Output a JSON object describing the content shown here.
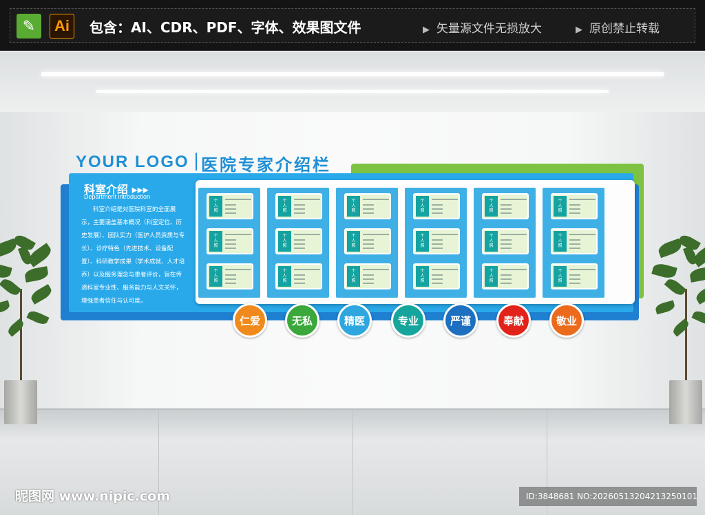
{
  "banner": {
    "ai_label": "Ai",
    "includes": "包含：AI、CDR、PDF、字体、效果图文件",
    "note1": "矢量源文件无损放大",
    "note2": "原创禁止转载"
  },
  "board": {
    "logo": "YOUR LOGO",
    "title": "医院专家介绍栏",
    "dept_title": "科室介绍 ▸▸▸",
    "dept_en": "Department introduction",
    "dept_text": "科室介绍是对医院科室的全面展示，主要涵盖基本概况（科室定位、历史发展）、团队实力（医护人员资质与专长）、诊疗特色（先进技术、设备配置）、科研教学成果（学术成就、人才培养）以及服务理念与患者评价，旨在传递科室专业性、服务能力与人文关怀，增强患者信任与认可度。",
    "card_photo_label": "个人照"
  },
  "values": [
    {
      "label": "仁爱",
      "color": "#f08a1c"
    },
    {
      "label": "无私",
      "color": "#3aa83a"
    },
    {
      "label": "精医",
      "color": "#2ea7e0"
    },
    {
      "label": "专业",
      "color": "#15a59c"
    },
    {
      "label": "严谨",
      "color": "#1d6fbf"
    },
    {
      "label": "奉献",
      "color": "#e2231a"
    },
    {
      "label": "敬业",
      "color": "#ec6a1c"
    }
  ],
  "watermark": {
    "site": "昵图网 www.nipic.com",
    "id": "ID:3848681 NO:20260513204213250101"
  }
}
